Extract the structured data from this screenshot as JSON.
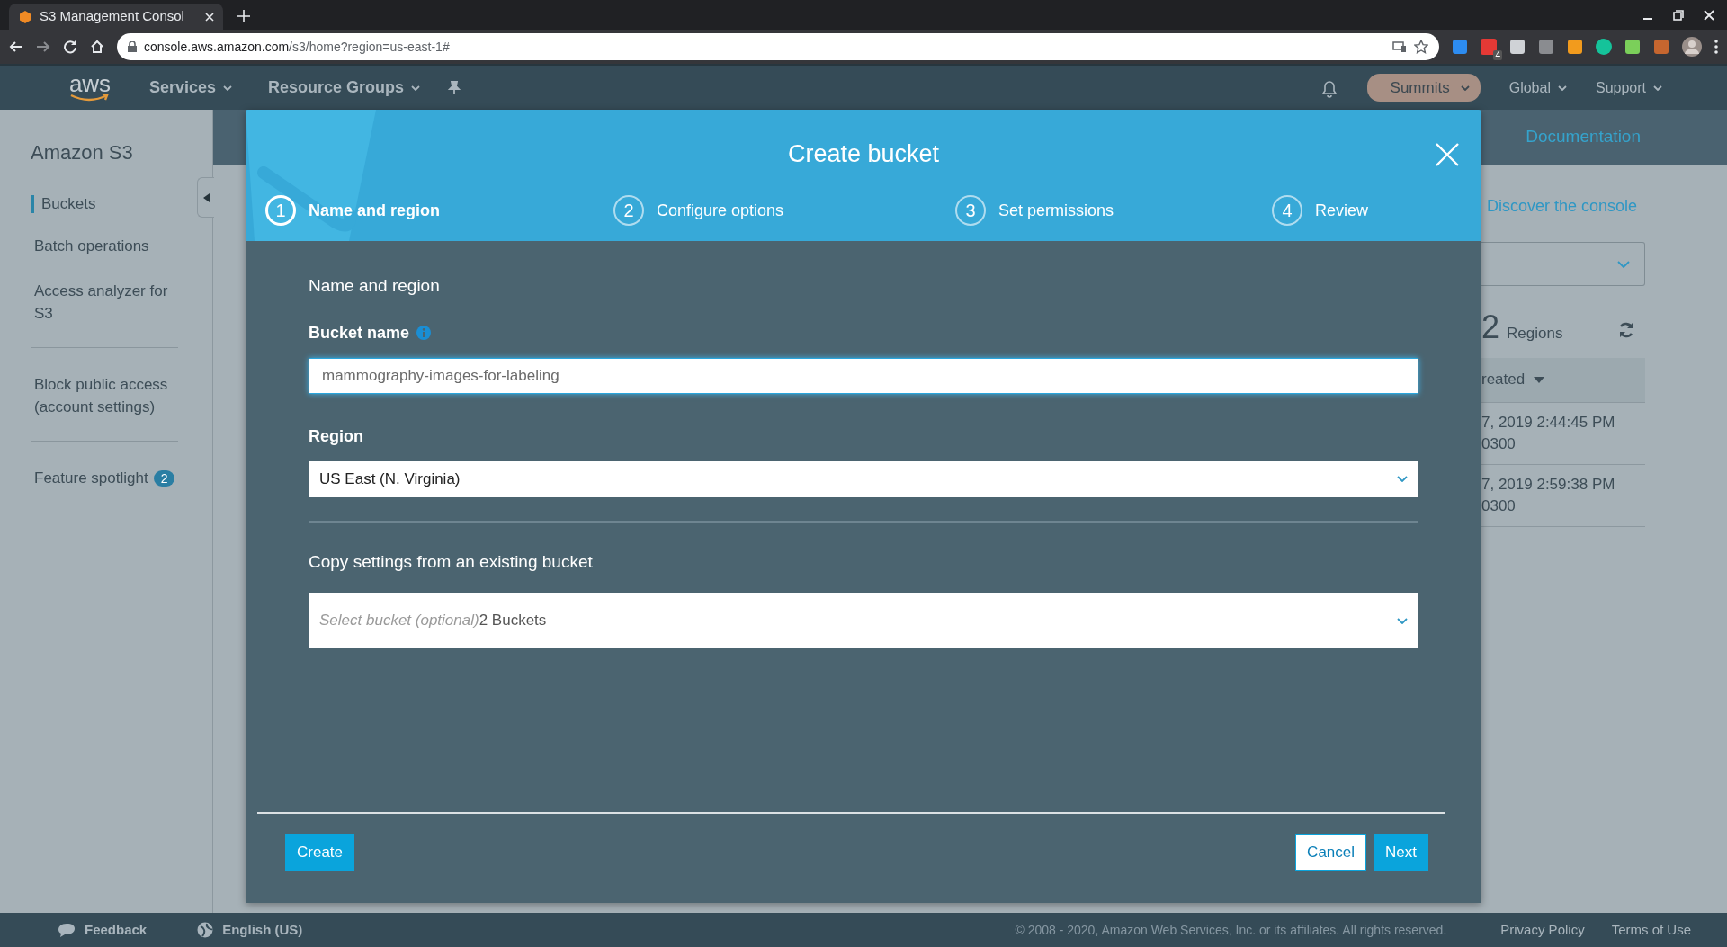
{
  "browser": {
    "tab_title": "S3 Management Consol",
    "url_host": "console.aws.amazon.com",
    "url_path": "/s3/home?region=us-east-1#",
    "extension_badge": "4"
  },
  "nav": {
    "logo": "aws",
    "menus": [
      "Services",
      "Resource Groups"
    ],
    "account": "Summits",
    "region": "Global",
    "support": "Support"
  },
  "sidebar": {
    "title": "Amazon S3",
    "groups": [
      [
        {
          "label": "Buckets",
          "selected": true
        },
        {
          "label": "Batch operations",
          "selected": false
        },
        {
          "label": "Access analyzer for S3",
          "selected": false
        }
      ],
      [
        {
          "label": "Block public access (account settings)",
          "selected": false
        }
      ],
      [
        {
          "label": "Feature spotlight",
          "selected": false,
          "badge": "2"
        }
      ]
    ]
  },
  "background": {
    "documentation": "Documentation",
    "discover": "Discover the console",
    "count": "2",
    "count_label": "Regions",
    "column_header": "reated",
    "rows": [
      {
        "line1": "7, 2019 2:44:45 PM",
        "line2": "0300"
      },
      {
        "line1": "7, 2019 2:59:38 PM",
        "line2": "0300"
      }
    ]
  },
  "modal": {
    "title": "Create bucket",
    "steps": [
      {
        "number": "1",
        "label": "Name and region",
        "selected": true
      },
      {
        "number": "2",
        "label": "Configure options",
        "selected": false
      },
      {
        "number": "3",
        "label": "Set permissions",
        "selected": false
      },
      {
        "number": "4",
        "label": "Review",
        "selected": false
      }
    ],
    "section_title": "Name and region",
    "bucket_label": "Bucket name",
    "bucket_value": "mammography-images-for-labeling",
    "region_label": "Region",
    "region_value": "US East (N. Virginia)",
    "copy_title": "Copy settings from an existing bucket",
    "copy_placeholder": "Select bucket (optional)",
    "copy_count": "2 Buckets",
    "buttons_left": [
      {
        "label": "Create",
        "kind": "primary"
      }
    ],
    "buttons_right": [
      {
        "label": "Cancel",
        "kind": "outline"
      },
      {
        "label": "Next",
        "kind": "primary"
      }
    ]
  },
  "footer": {
    "feedback": "Feedback",
    "language": "English (US)",
    "copyright": "© 2008 - 2020, Amazon Web Services, Inc. or its affiliates. All rights reserved.",
    "links": [
      "Privacy Policy",
      "Terms of Use"
    ]
  }
}
